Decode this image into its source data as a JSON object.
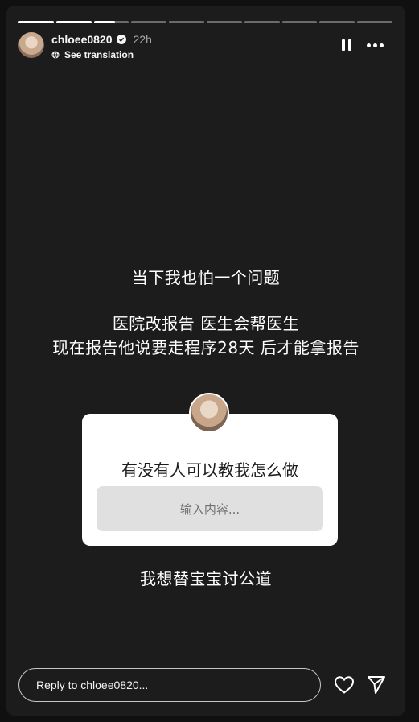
{
  "progress": {
    "segments": [
      1,
      1,
      0.6,
      0,
      0,
      0,
      0,
      0,
      0,
      0
    ]
  },
  "header": {
    "username": "chloee0820",
    "time": "22h",
    "translation_label": "See translation"
  },
  "story_text": {
    "line1": "当下我也怕一个问题",
    "line2": "医院改报告 医生会帮医生",
    "line3": "现在报告他说要走程序28天 后才能拿报告",
    "line4": "我想替宝宝讨公道"
  },
  "question_sticker": {
    "title": "有没有人可以教我怎么做",
    "placeholder": "输入内容..."
  },
  "reply": {
    "placeholder": "Reply to chloee0820..."
  },
  "icons": {
    "pause": "pause-icon",
    "more": "more-icon",
    "heart": "heart-icon",
    "share": "send-icon",
    "verified": "verified-badge-icon",
    "translation": "globe-icon"
  },
  "colors": {
    "background": "#1c1c1c",
    "card": "#ffffff",
    "input": "#e0e0e0"
  }
}
